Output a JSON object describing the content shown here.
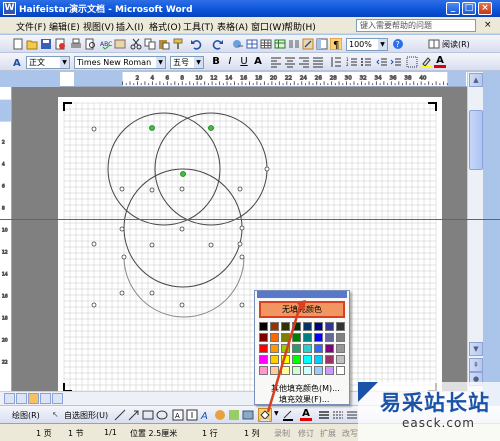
{
  "window": {
    "title": "Haifeistar演示文档 - Microsoft Word",
    "app_icon": "W",
    "min": "_",
    "max": "□",
    "close": "×"
  },
  "menu": {
    "items": [
      "文件(F)",
      "编辑(E)",
      "视图(V)",
      "插入(I)",
      "格式(O)",
      "工具(T)",
      "表格(A)",
      "窗口(W)",
      "帮助(H)"
    ],
    "help_placeholder": "键入需要帮助的问题",
    "close": "×"
  },
  "toolbar": {
    "zoom": "100%",
    "reading_mode": "阅读(R)"
  },
  "format": {
    "style": "正文",
    "font": "Times New Roman",
    "size": "五号"
  },
  "ruler": {
    "h_ticks": [
      "2",
      "4",
      "6",
      "8",
      "10",
      "12",
      "14",
      "16",
      "18",
      "20",
      "22",
      "24",
      "26",
      "28",
      "30",
      "32",
      "34",
      "36",
      "38",
      "40"
    ],
    "v_ticks": [
      "2",
      "4",
      "6",
      "8",
      "10",
      "12",
      "14",
      "16",
      "18",
      "20",
      "22"
    ]
  },
  "color_popup": {
    "no_fill": "无填充颜色",
    "more_colors": "其他填充颜色(M)...",
    "fill_effects": "填充效果(F)...",
    "swatch_colors": [
      "#000000",
      "#993300",
      "#333300",
      "#003300",
      "#003366",
      "#000080",
      "#333399",
      "#333333",
      "#800000",
      "#ff6600",
      "#808000",
      "#008000",
      "#008080",
      "#0000ff",
      "#666699",
      "#808080",
      "#ff0000",
      "#ff9900",
      "#99cc00",
      "#339966",
      "#33cccc",
      "#3366ff",
      "#800080",
      "#969696",
      "#ff00ff",
      "#ffcc00",
      "#ffff00",
      "#00ff00",
      "#00ffff",
      "#00ccff",
      "#993366",
      "#c0c0c0",
      "#ff99cc",
      "#ffcc99",
      "#ffff99",
      "#ccffcc",
      "#ccffff",
      "#99ccff",
      "#cc99ff",
      "#ffffff"
    ]
  },
  "draw_toolbar": {
    "draw": "绘图(R)",
    "autoshapes": "自选图形(U)"
  },
  "status": {
    "page": "1 页",
    "section": "1 节",
    "page_of": "1/1",
    "position": "位置 2.5厘米",
    "line": "1 行",
    "column": "1 列",
    "rec": "录制",
    "trk": "修订",
    "ext": "扩展",
    "ovr": "改写"
  },
  "watermark": {
    "line1": "易采站长站",
    "line2": "easck.com"
  },
  "colors": {
    "title_bar": "#0a53d8",
    "selection_red": "#d94020",
    "no_fill_bg": "#f09660"
  }
}
